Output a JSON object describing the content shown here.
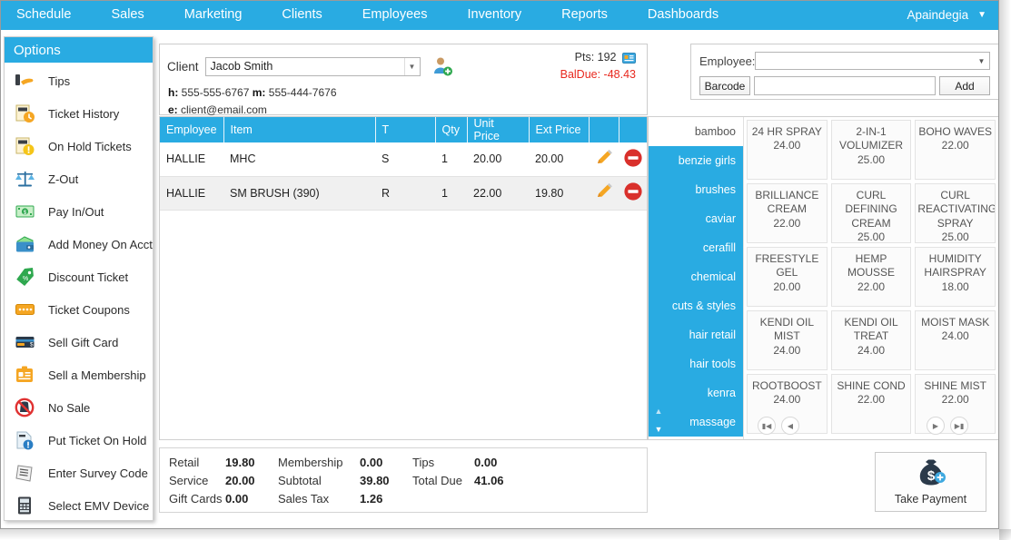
{
  "menubar": {
    "items": [
      {
        "label": "Schedule",
        "name": "menu-schedule"
      },
      {
        "label": "Sales",
        "name": "menu-sales"
      },
      {
        "label": "Marketing",
        "name": "menu-marketing"
      },
      {
        "label": "Clients",
        "name": "menu-clients"
      },
      {
        "label": "Employees",
        "name": "menu-employees"
      },
      {
        "label": "Inventory",
        "name": "menu-inventory"
      },
      {
        "label": "Reports",
        "name": "menu-reports"
      },
      {
        "label": "Dashboards",
        "name": "menu-dashboards"
      }
    ],
    "account": "Apaindegia",
    "accent": "#29ABE2"
  },
  "sidebar": {
    "header": "Options",
    "items": [
      {
        "label": "Tips",
        "icon": "tips-icon"
      },
      {
        "label": "Ticket History",
        "icon": "ticket-history-icon"
      },
      {
        "label": "On Hold Tickets",
        "icon": "on-hold-tickets-icon"
      },
      {
        "label": "Z-Out",
        "icon": "scale-icon"
      },
      {
        "label": "Pay In/Out",
        "icon": "cash-icon"
      },
      {
        "label": "Add Money On Acct",
        "icon": "wallet-icon"
      },
      {
        "label": "Discount Ticket",
        "icon": "discount-tag-icon"
      },
      {
        "label": "Ticket Coupons",
        "icon": "coupon-icon"
      },
      {
        "label": "Sell Gift Card",
        "icon": "gift-card-icon"
      },
      {
        "label": "Sell a Membership",
        "icon": "membership-card-icon"
      },
      {
        "label": "No Sale",
        "icon": "no-sale-icon"
      },
      {
        "label": "Put Ticket On Hold",
        "icon": "hold-document-icon"
      },
      {
        "label": "Enter Survey Code",
        "icon": "survey-icon"
      },
      {
        "label": "Select EMV Device",
        "icon": "emv-terminal-icon"
      }
    ]
  },
  "client": {
    "label": "Client",
    "name": "Jacob Smith",
    "placeholder": "",
    "points_label": "Pts: 192",
    "balance_due": "BalDue: -48.43",
    "balance_color": "#E8281E",
    "phone_line": "555-555-6767",
    "phone_prefix": "h:",
    "mobile_prefix": "m:",
    "mobile_line": "555-444-7676",
    "email_prefix": "e:",
    "email": "client@email.com"
  },
  "employee_panel": {
    "label": "Employee:",
    "selected": "",
    "barcode_label": "Barcode",
    "barcode_value": "",
    "add_label": "Add"
  },
  "ticket": {
    "columns": [
      "Employee",
      "Item",
      "T",
      "Qty",
      "Unit Price",
      "Ext Price",
      "",
      ""
    ],
    "rows": [
      {
        "employee": "HALLIE",
        "item": "MHC",
        "t": "S",
        "qty": "1",
        "unit_price": "20.00",
        "ext_price": "20.00"
      },
      {
        "employee": "HALLIE",
        "item": "SM BRUSH (390)",
        "t": "R",
        "qty": "1",
        "unit_price": "22.00",
        "ext_price": "19.80"
      }
    ]
  },
  "totals": {
    "rows": [
      {
        "l1": "Retail",
        "v1": "19.80",
        "l2": "Membership",
        "v2": "0.00",
        "l3": "Tips",
        "v3": "0.00"
      },
      {
        "l1": "Service",
        "v1": "20.00",
        "l2": "Subtotal",
        "v2": "39.80",
        "l3": "Total Due",
        "v3": "41.06"
      },
      {
        "l1": "Gift Cards",
        "v1": "0.00",
        "l2": "Sales Tax",
        "v2": "1.26",
        "l3": "",
        "v3": ""
      }
    ]
  },
  "categories": [
    {
      "label": "bamboo",
      "selected": false
    },
    {
      "label": "benzie girls",
      "selected": true
    },
    {
      "label": "brushes",
      "selected": true
    },
    {
      "label": "caviar",
      "selected": true
    },
    {
      "label": "cerafill",
      "selected": true
    },
    {
      "label": "chemical",
      "selected": true
    },
    {
      "label": "cuts & styles",
      "selected": true
    },
    {
      "label": "hair retail",
      "selected": true
    },
    {
      "label": "hair tools",
      "selected": true
    },
    {
      "label": "kenra",
      "selected": true
    },
    {
      "label": "massage",
      "selected": true
    }
  ],
  "products": [
    {
      "name": "24 HR SPRAY",
      "price": "24.00"
    },
    {
      "name": "2-IN-1 VOLUMIZER",
      "price": "25.00"
    },
    {
      "name": "BOHO WAVES",
      "price": "22.00"
    },
    {
      "name": "BRILLIANCE CREAM",
      "price": "22.00"
    },
    {
      "name": "CURL DEFINING CREAM",
      "price": "25.00"
    },
    {
      "name": "CURL REACTIVATING SPRAY",
      "price": "25.00"
    },
    {
      "name": "FREESTYLE GEL",
      "price": "20.00"
    },
    {
      "name": "HEMP MOUSSE",
      "price": "22.00"
    },
    {
      "name": "HUMIDITY HAIRSPRAY",
      "price": "18.00"
    },
    {
      "name": "KENDI OIL MIST",
      "price": "24.00"
    },
    {
      "name": "KENDI OIL TREAT",
      "price": "24.00"
    },
    {
      "name": "MOIST MASK",
      "price": "24.00"
    },
    {
      "name": "ROOTBOOST",
      "price": "24.00"
    },
    {
      "name": "SHINE COND",
      "price": "22.00"
    },
    {
      "name": "SHINE MIST",
      "price": "22.00"
    }
  ],
  "pager": {
    "first": "⏮",
    "prev": "◀",
    "next": "▶",
    "last": "⏭"
  },
  "take_payment": {
    "label": "Take Payment"
  }
}
